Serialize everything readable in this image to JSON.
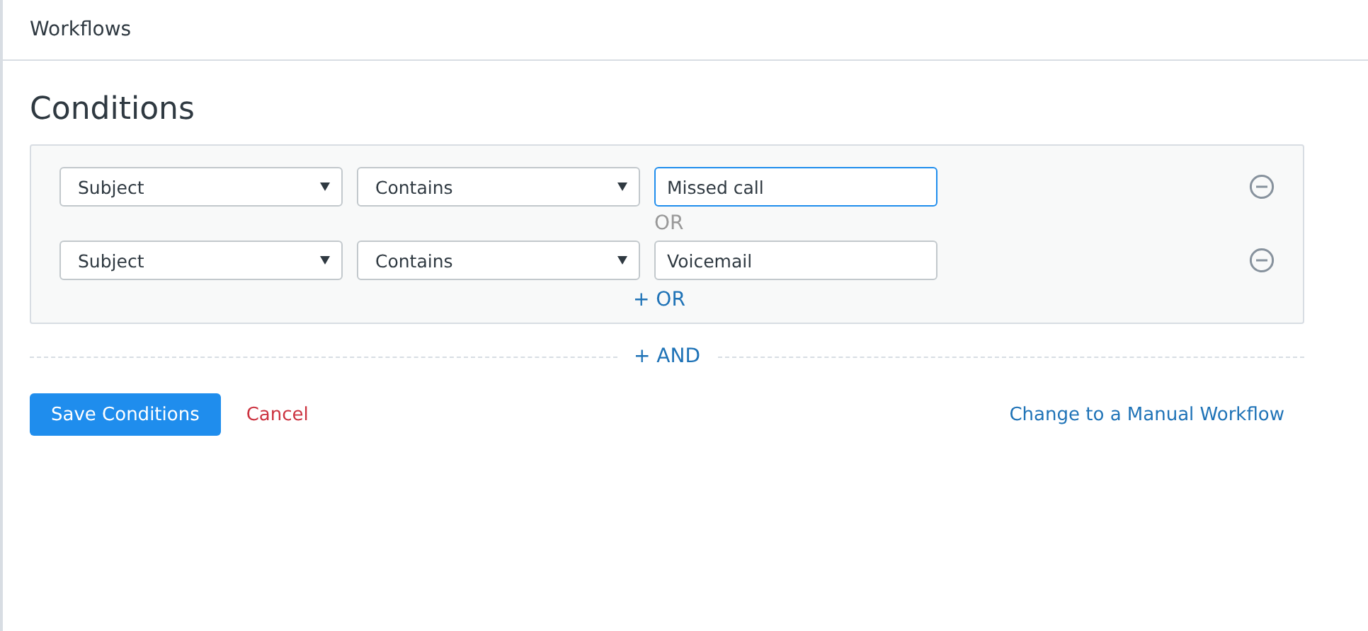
{
  "header": {
    "title": "Workflows"
  },
  "conditions": {
    "title": "Conditions",
    "groups": [
      {
        "rows": [
          {
            "field": "Subject",
            "operator": "Contains",
            "value": "Missed call",
            "focused": true
          },
          {
            "field": "Subject",
            "operator": "Contains",
            "value": "Voicemail",
            "focused": false
          }
        ],
        "separator": "OR",
        "add_or": "+ OR"
      }
    ],
    "add_and": "+ AND"
  },
  "actions": {
    "save": "Save Conditions",
    "cancel": "Cancel",
    "manual": "Change to a Manual Workflow"
  }
}
